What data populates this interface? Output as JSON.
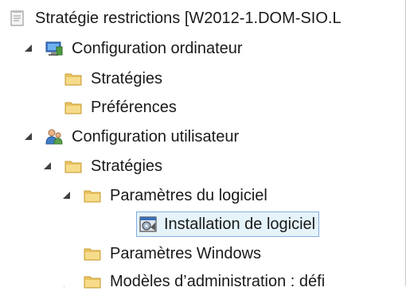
{
  "tree": {
    "root": {
      "label": "Stratégie restrictions [W2012-1.DOM-SIO.L",
      "icon": "policy-document-icon"
    },
    "computer_config": {
      "label": "Configuration ordinateur",
      "icon": "computer-config-icon",
      "expanded": true,
      "children": {
        "strategies": {
          "label": "Stratégies",
          "icon": "folder-icon",
          "expanded": false
        },
        "preferences": {
          "label": "Préférences",
          "icon": "folder-icon",
          "expanded": false
        }
      }
    },
    "user_config": {
      "label": "Configuration utilisateur",
      "icon": "user-config-icon",
      "expanded": true,
      "children": {
        "strategies": {
          "label": "Stratégies",
          "icon": "folder-icon",
          "expanded": true,
          "children": {
            "software_settings": {
              "label": "Paramètres du logiciel",
              "icon": "folder-icon",
              "expanded": true,
              "children": {
                "software_installation": {
                  "label": "Installation de logiciel",
                  "icon": "software-installation-icon",
                  "selected": true
                }
              }
            },
            "windows_settings": {
              "label": "Paramètres Windows",
              "icon": "folder-icon",
              "expanded": false
            },
            "admin_templates": {
              "label": "Modèles d’administration : défi",
              "icon": "folder-icon",
              "expanded": false
            }
          }
        }
      }
    }
  },
  "colors": {
    "folder": "#e9c25f",
    "folder_light": "#f6dc8a",
    "selection_bg": "#e5f3fb",
    "selection_border": "#84acdd"
  }
}
